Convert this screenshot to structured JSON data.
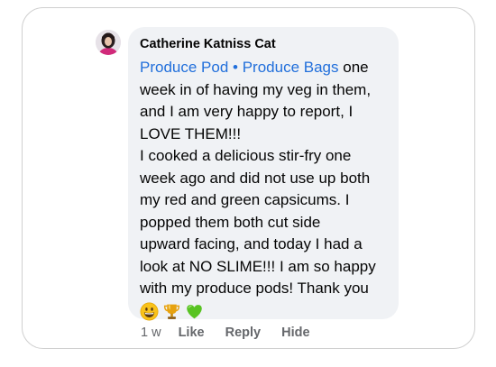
{
  "comment": {
    "author": "Catherine Katniss Cat",
    "tags": [
      "Produce Pod",
      "Produce Bags"
    ],
    "tag_separator": "•",
    "lines_first": [
      " one"
    ],
    "lines": [
      "week in of having my veg in them,",
      "and I am very happy to report, I",
      "LOVE THEM!!!",
      "I cooked a delicious stir-fry one",
      "week ago and did not use up both",
      "my red and green capsicums. I",
      "popped them both cut side",
      "upward facing, and today I had a",
      "look at NO SLIME!!! I am so happy",
      "with my produce pods! Thank you"
    ],
    "emojis": [
      "grinning-face-icon",
      "trophy-icon",
      "green-heart-icon"
    ]
  },
  "actions": {
    "time": "1 w",
    "like": "Like",
    "reply": "Reply",
    "hide": "Hide"
  },
  "colors": {
    "link": "#216fdb",
    "bubble": "#f0f2f5",
    "meta": "#65676b",
    "text": "#050505"
  }
}
